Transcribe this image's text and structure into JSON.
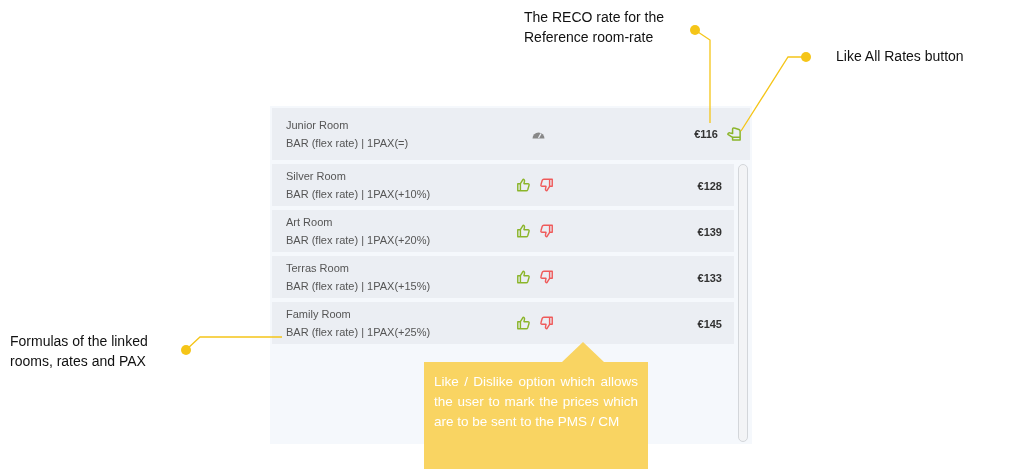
{
  "reference_row": {
    "room": "Junior Room",
    "formula": "BAR (flex rate) | 1PAX(=)",
    "price": "€116"
  },
  "rows": [
    {
      "room": "Silver Room",
      "formula": "BAR (flex rate) | 1PAX(+10%)",
      "price": "€128"
    },
    {
      "room": "Art Room",
      "formula": "BAR (flex rate) | 1PAX(+20%)",
      "price": "€139"
    },
    {
      "room": "Terras Room",
      "formula": "BAR (flex rate) | 1PAX(+15%)",
      "price": "€133"
    },
    {
      "room": "Family Room",
      "formula": "BAR (flex rate) | 1PAX(+25%)",
      "price": "€145"
    }
  ],
  "annotations": {
    "reco_rate": "The RECO rate for the Reference room-rate",
    "like_all": "Like All Rates button",
    "formulas": "Formulas of the linked rooms, rates and PAX",
    "like_dislike": "Like / Dislike option which allows the user to mark the prices which are to be sent to the PMS / CM"
  }
}
